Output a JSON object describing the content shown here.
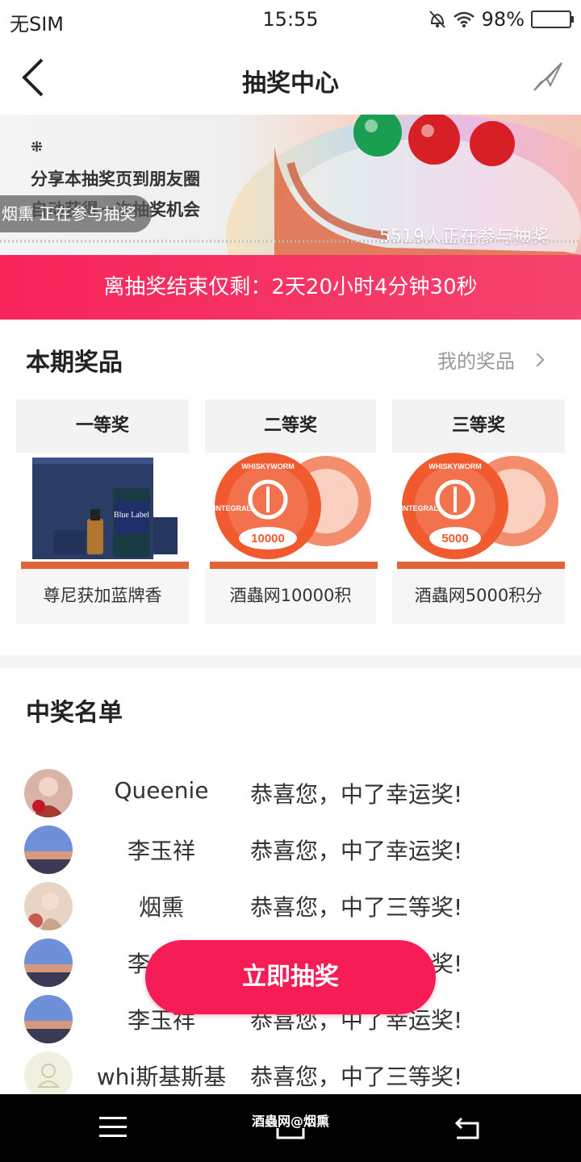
{
  "status_bar": {
    "carrier": "无SIM",
    "time": "15:55",
    "battery": "98%",
    "battery_level": 0.98
  },
  "nav": {
    "title": "抽奖中心",
    "back_icon": "chevron-left-icon",
    "share_icon": "share-arrow-icon"
  },
  "banner": {
    "logo": "⁜",
    "line1": "分享本抽奖页到朋友圈",
    "line2": "自动获得一次抽奖机会",
    "participating_pill": "烟熏 正在参与抽奖",
    "participant_count": "5519人正在参与抽奖"
  },
  "countdown": {
    "text": "离抽奖结束仅剩：2天20小时4分钟30秒"
  },
  "prizes": {
    "title": "本期奖品",
    "my_prizes_link": "我的奖品",
    "items": [
      {
        "tier": "一等奖",
        "name": "尊尼获加蓝牌香",
        "image": "whisky-gift-box"
      },
      {
        "tier": "二等奖",
        "name": "酒蟲网10000积",
        "badge": "10000",
        "seal": "INTEGRAL",
        "seal_brand": "WHISKYWORM"
      },
      {
        "tier": "三等奖",
        "name": "酒蟲网5000积分",
        "badge": "5000",
        "seal": "INTEGRAL",
        "seal_brand": "WHISKYWORM"
      }
    ]
  },
  "winners": {
    "title": "中奖名单",
    "rows": [
      {
        "name": "Queenie",
        "message": "恭喜您，中了幸运奖!",
        "avatar": "photo-woman-flowers"
      },
      {
        "name": "李玉祥",
        "message": "恭喜您，中了幸运奖!",
        "avatar": "photo-city-dusk"
      },
      {
        "name": "烟熏",
        "message": "恭喜您，中了三等奖!",
        "avatar": "photo-woman-hair"
      },
      {
        "name": "李玉祥",
        "message": "恭喜您，中了幸运奖!",
        "avatar": "photo-city-dusk"
      },
      {
        "name": "李玉祥",
        "message": "恭喜您，中了幸运奖!",
        "avatar": "photo-city-dusk"
      },
      {
        "name": "whi斯基斯基",
        "message": "恭喜您，中了三等奖!",
        "avatar": "default-user-icon"
      }
    ]
  },
  "draw_button": {
    "label": "立即抽奖"
  },
  "watermark": "酒蟲网@烟熏",
  "colors": {
    "accent": "#f61d56",
    "countdown_bg": "#f7245a",
    "muted_text": "#999999"
  }
}
